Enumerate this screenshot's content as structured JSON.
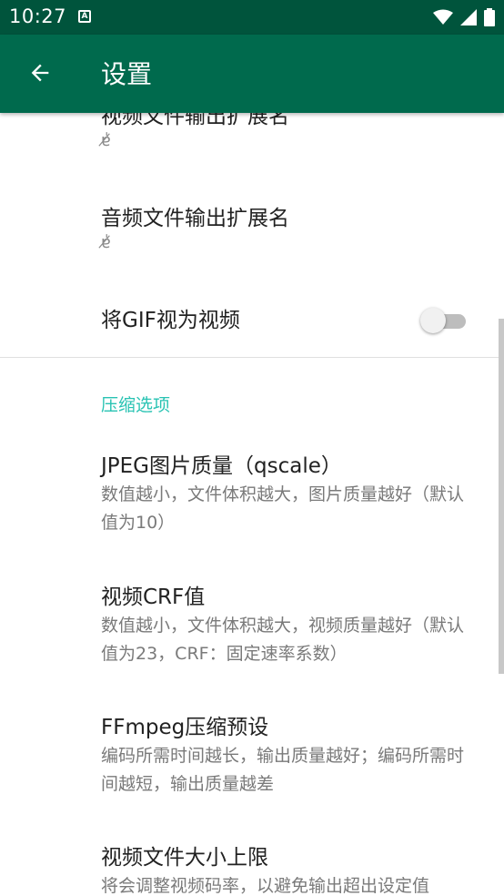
{
  "status_bar": {
    "time": "10:27",
    "notification_icon": "a-badge-icon",
    "icons": [
      "wifi-icon",
      "signal-icon",
      "battery-icon"
    ]
  },
  "app_bar": {
    "title": "设置",
    "back_icon": "arrow-left-icon"
  },
  "prefs": {
    "video_ext": {
      "title": "视频文件输出扩展名",
      "summary": "ɐ̸̍"
    },
    "audio_ext": {
      "title": "音频文件输出扩展名",
      "summary": "ɐ̸̍"
    },
    "gif_as_video": {
      "title": "将GIF视为视频",
      "enabled": false
    }
  },
  "section_compress": "压缩选项",
  "compress": {
    "jpeg": {
      "title": "JPEG图片质量（qscale）",
      "summary": "数值越小，文件体积越大，图片质量越好（默认值为10）"
    },
    "crf": {
      "title": "视频CRF值",
      "summary": "数值越小，文件体积越大，视频质量越好（默认值为23，CRF：固定速率系数）"
    },
    "preset": {
      "title": "FFmpeg压缩预设",
      "summary": "编码所需时间越长，输出质量越好；编码所需时间越短，输出质量越差"
    },
    "size_limit": {
      "title": "视频文件大小上限",
      "summary": "将会调整视频码率，以避免输出超出设定值"
    }
  },
  "colors": {
    "status_bar": "#00543c",
    "app_bar": "#006a4d",
    "accent": "#29c3b3"
  }
}
